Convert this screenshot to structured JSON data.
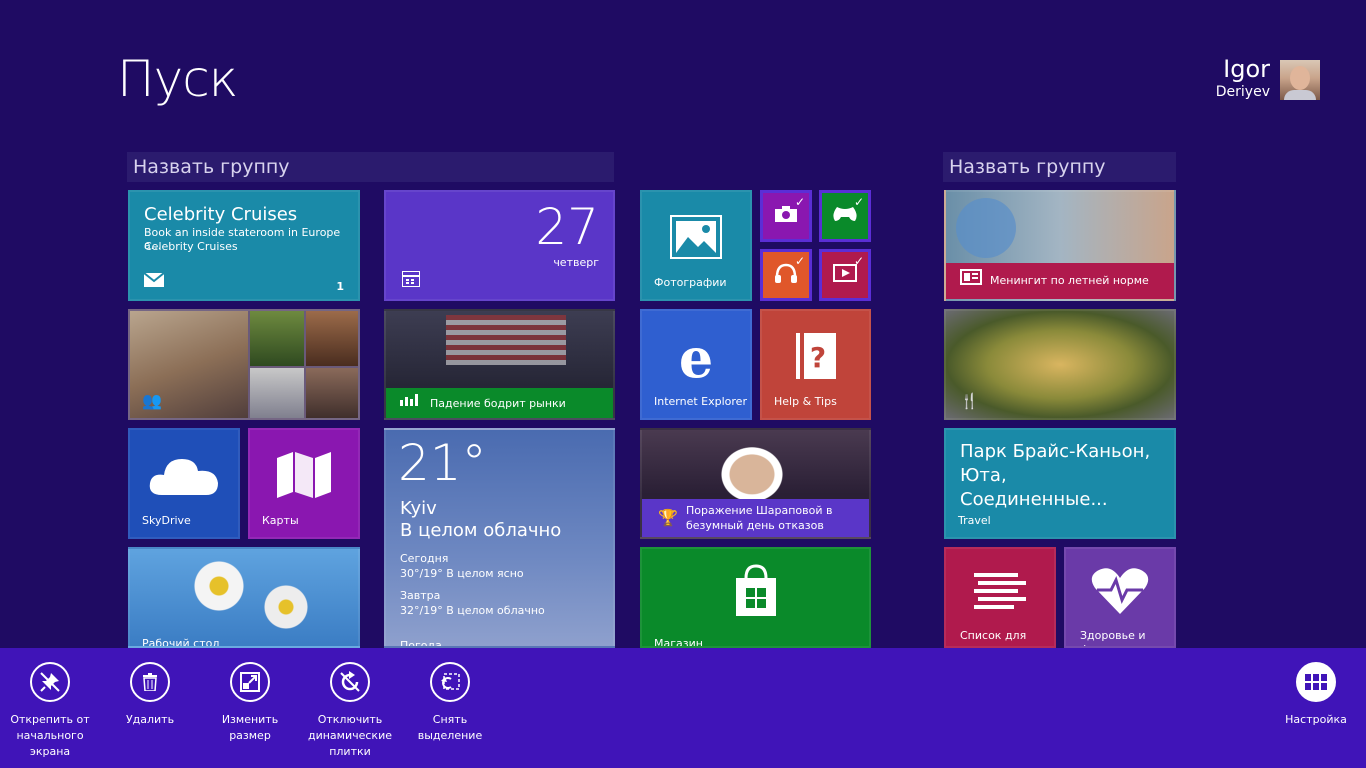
{
  "start": {
    "title": "Пуск"
  },
  "user": {
    "first_name": "Igor",
    "last_name": "Deriyev"
  },
  "groups": [
    {
      "name": "Назвать группу"
    },
    {
      "name": "Назвать группу"
    }
  ],
  "tiles": {
    "mail": {
      "title": "Celebrity Cruises",
      "line1": "Book an inside stateroom in Europe a...",
      "line2": "Celebrity Cruises",
      "count": "1"
    },
    "calendar": {
      "day": "27",
      "weekday": "четверг"
    },
    "photos": {
      "label": "Фотографии"
    },
    "finance": {
      "label": "Падение бодрит рынки"
    },
    "ie": {
      "label": "Internet Explorer"
    },
    "help": {
      "label": "Help & Tips"
    },
    "skydrive": {
      "label": "SkyDrive"
    },
    "maps": {
      "label": "Карты"
    },
    "weather": {
      "temp": "21°",
      "city": "Kyiv",
      "condition": "В целом облачно",
      "today_label": "Сегодня",
      "today_value": "30°/19° В целом ясно",
      "tomorrow_label": "Завтра",
      "tomorrow_value": "32°/19° В целом облачно",
      "label": "Погода"
    },
    "sports": {
      "label": "Поражение Шараповой в безумный день отказов"
    },
    "desktop": {
      "label": "Рабочий стол"
    },
    "store": {
      "label": "Магазин"
    },
    "news": {
      "label": "Менингит по летней норме"
    },
    "travel": {
      "title": "Парк Брайс-Каньон, Юта, Соединенные...",
      "label": "Travel"
    },
    "reading": {
      "label": "Список для чтения"
    },
    "health": {
      "label": "Здоровье и фитнес"
    }
  },
  "appbar": {
    "unpin": "Открепить от начального экрана",
    "delete": "Удалить",
    "resize": "Изменить размер",
    "live_off": "Отключить динамические плитки",
    "clear": "Снять выделение",
    "customize": "Настройка"
  },
  "colors": {
    "background": "#1f0b63",
    "appbar": "#4014b8",
    "mail_tile": "#1a8aa8",
    "calendar_tile": "#5a36c8",
    "photos_tile": "#1a8aa8",
    "ie_tile": "#2f5fd0",
    "help_tile": "#c0443a",
    "skydrive_tile": "#1f4fb8",
    "maps_tile": "#8a17b0",
    "store_tile": "#0a8a2a",
    "travel_tile": "#1a8aa8",
    "reading_tile": "#b01a4d",
    "health_tile": "#6a3aa8"
  }
}
